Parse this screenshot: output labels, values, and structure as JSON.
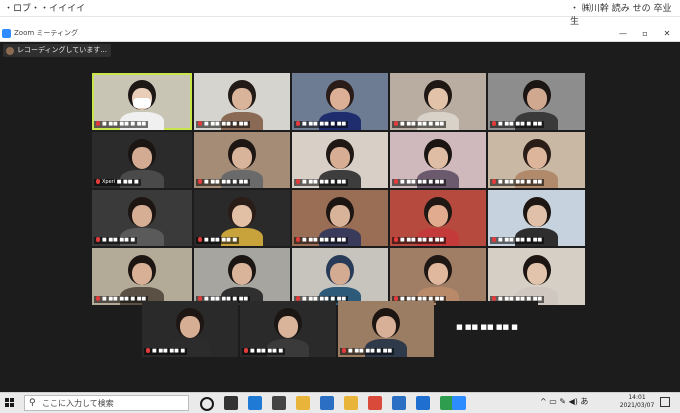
{
  "top_strip": {
    "left_text": "・ロブ・・イイイイ",
    "right_text": "・ ㈱川幹 読み せの 卒业生"
  },
  "window": {
    "title": "Zoom ミーティング",
    "controls": [
      "—",
      "▫",
      "✕"
    ]
  },
  "meeting": {
    "recording_label": "レコーディングしています...",
    "tiles": [
      {
        "name": "■ ■■ ■■ ■ ■■",
        "active": true,
        "bg": "#c9c5b5",
        "hair": "#1d1715",
        "skin": "#e8cdb9",
        "shirt": "#f0f0f0",
        "mask": true
      },
      {
        "name": "■ ■■ ■■ ■ ■■",
        "active": false,
        "bg": "#d6d4cf",
        "hair": "#221a17",
        "skin": "#d9b49b",
        "shirt": "#8a6a55"
      },
      {
        "name": "■ ■■ ■■ ■ ■■",
        "active": false,
        "bg": "#6d7c93",
        "hair": "#2a1c18",
        "skin": "#dcb096",
        "shirt": "#1f2d6e"
      },
      {
        "name": "■ ■■ ■■ ■ ■■",
        "active": false,
        "bg": "#b9ada1",
        "hair": "#1f1714",
        "skin": "#e2c2a9",
        "shirt": "#d8d2c8"
      },
      {
        "name": "■ ■■ ■■ ■ ■■",
        "active": false,
        "bg": "#8d8d8d",
        "hair": "#1b1513",
        "skin": "#cfa88f",
        "shirt": "#3a3a3a"
      },
      {
        "name": "Xperi ■ ■■ ■",
        "active": false,
        "bg": "#2b2b2b",
        "hair": "#1b1513",
        "skin": "#d2ab92",
        "shirt": "#4a4a4a"
      },
      {
        "name": "■ ■■ ■■ ■ ■■",
        "active": false,
        "bg": "#a48c76",
        "hair": "#1d1613",
        "skin": "#d8b49b",
        "shirt": "#6a6a6a"
      },
      {
        "name": "■ ■■ ■■ ■ ■■",
        "active": false,
        "bg": "#d8d0c7",
        "hair": "#1f1815",
        "skin": "#d7ae94",
        "shirt": "#3d3d3d"
      },
      {
        "name": "■ ■■ ■■ ■ ■■",
        "active": false,
        "bg": "#cfb9bd",
        "hair": "#1a1412",
        "skin": "#dfbca4",
        "shirt": "#6b5a6e"
      },
      {
        "name": "■ ■■ ■■ ■ ■■",
        "active": false,
        "bg": "#c8b8a4",
        "hair": "#2a1d18",
        "skin": "#dcb59b",
        "shirt": "#b08a6a"
      },
      {
        "name": "■ ■■ ■■ ■",
        "active": false,
        "bg": "#3a3a3a",
        "hair": "#1c1512",
        "skin": "#d6ae94",
        "shirt": "#5a5a5a"
      },
      {
        "name": "■ ■■ ■■ ■",
        "active": false,
        "bg": "#2a2a2a",
        "hair": "#2a1d18",
        "skin": "#e2c0a5",
        "shirt": "#c8a23a"
      },
      {
        "name": "■ ■■ ■■ ■ ■■",
        "active": false,
        "bg": "#9a6e55",
        "hair": "#1c1512",
        "skin": "#d9b29a",
        "shirt": "#3a3a5a"
      },
      {
        "name": "■ ■■ ■■ ■ ■■",
        "active": false,
        "bg": "#b74a3e",
        "hair": "#1f1714",
        "skin": "#e0ab8e",
        "shirt": "#c43a3a"
      },
      {
        "name": "■ ■■ ■■ ■ ■■",
        "active": false,
        "bg": "#c6d2de",
        "hair": "#1d1613",
        "skin": "#e0c0a8",
        "shirt": "#2e2e2e"
      },
      {
        "name": "■ ■■ ■■ ■ ■■",
        "active": false,
        "bg": "#b3aa97",
        "hair": "#1c1512",
        "skin": "#d8b096",
        "shirt": "#5a5044"
      },
      {
        "name": "■ ■■ ■■ ■ ■■",
        "active": false,
        "bg": "#a7a59f",
        "hair": "#1b1513",
        "skin": "#d9b49b",
        "shirt": "#2f2f2f"
      },
      {
        "name": "■ ■■ ■■ ■ ■■",
        "active": false,
        "bg": "#c7c4bd",
        "hair": "#273b58",
        "skin": "#d2ab92",
        "shirt": "#2d5a78"
      },
      {
        "name": "■ ■■ ■■ ■ ■■",
        "active": false,
        "bg": "#a07e66",
        "hair": "#1f1714",
        "skin": "#dfb89e",
        "shirt": "#b88a6a"
      },
      {
        "name": "■ ■■ ■■ ■ ■■",
        "active": false,
        "bg": "#d6cfc6",
        "hair": "#1c1512",
        "skin": "#e2c4ac",
        "shirt": "#d0c8c0"
      },
      {
        "name": "■ ■■ ■■ ■",
        "active": false,
        "bg": "#2a2a2a",
        "hair": "#1d1613",
        "skin": "#d6ae94",
        "shirt": "#2c2c2c"
      },
      {
        "name": "■ ■■ ■■ ■",
        "active": false,
        "bg": "#2a2a2a",
        "hair": "#1b1513",
        "skin": "#d9b49b",
        "shirt": "#3a3a3a"
      },
      {
        "name": "■ ■■ ■■ ■ ■■",
        "active": false,
        "bg": "#9b7d63",
        "hair": "#1c1512",
        "skin": "#d7b097",
        "shirt": "#2e3a4a"
      },
      {
        "name": "■ ■■ ■■ ■■ ■",
        "active": false,
        "bg": "#1c1c1c",
        "blank": true
      }
    ]
  },
  "taskbar": {
    "search_placeholder": "ここに入力して検索",
    "app_icons": [
      {
        "name": "cortana-icon",
        "color": "#1a1a1a"
      },
      {
        "name": "task-view-icon",
        "color": "#333333"
      },
      {
        "name": "edge-icon",
        "color": "#1f7ad6"
      },
      {
        "name": "store-icon",
        "color": "#444444"
      },
      {
        "name": "explorer-icon",
        "color": "#e8b53a"
      },
      {
        "name": "mail-icon",
        "color": "#2a6fc4"
      },
      {
        "name": "folder-icon",
        "color": "#e8b53a"
      },
      {
        "name": "chrome-icon",
        "color": "#d94a3a"
      },
      {
        "name": "network-app-icon",
        "color": "#2a6fc4"
      },
      {
        "name": "photos-icon",
        "color": "#1f6fd0"
      },
      {
        "name": "chrome-alt-icon",
        "color": "#2e9e4e"
      },
      {
        "name": "zoom-icon",
        "color": "#2d8cff"
      }
    ],
    "tray_text": "^ ▭ ✎ ◀) あ",
    "time": "14:01",
    "date": "2021/03/07"
  }
}
